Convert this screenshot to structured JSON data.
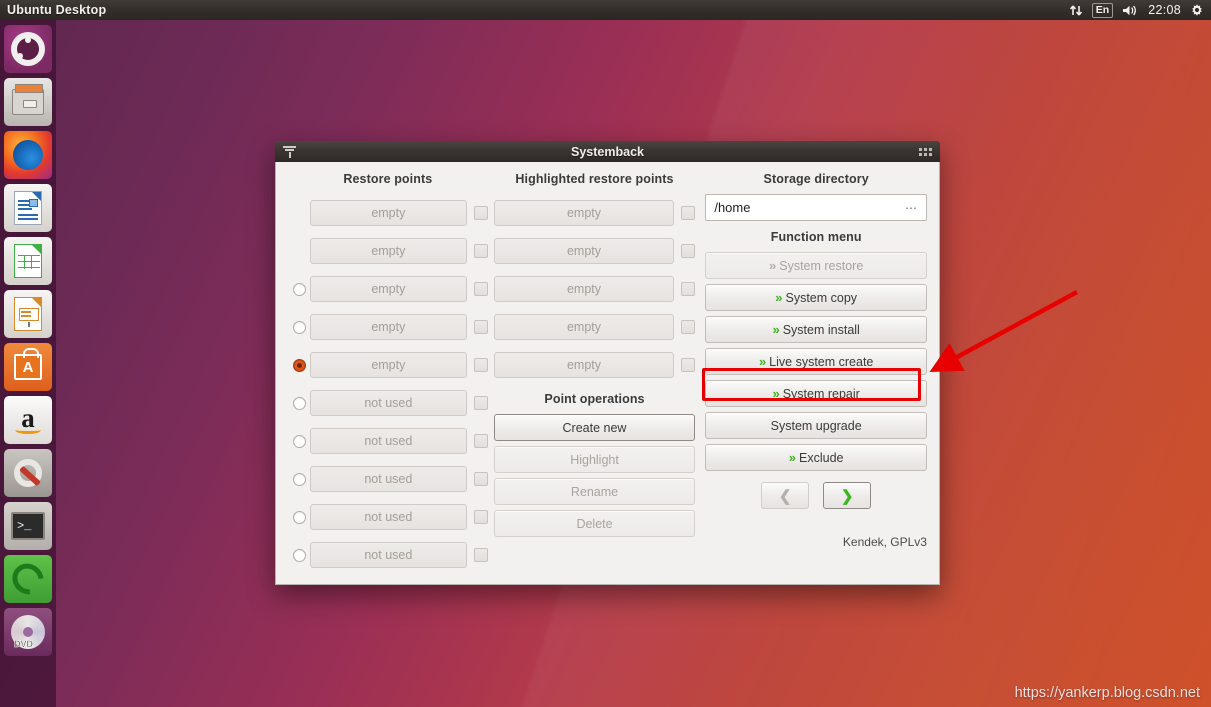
{
  "panel": {
    "title": "Ubuntu Desktop",
    "indicators": {
      "network_icon": "network-updown-icon",
      "keyboard": "En",
      "volume_icon": "volume-icon",
      "clock": "22:08",
      "gear_icon": "gear-icon"
    }
  },
  "launcher": {
    "items": [
      {
        "name": "ubuntu-dash",
        "label": "Ubuntu Dash"
      },
      {
        "name": "files",
        "label": "Files"
      },
      {
        "name": "firefox",
        "label": "Firefox"
      },
      {
        "name": "libreoffice-writer",
        "label": "LibreOffice Writer"
      },
      {
        "name": "libreoffice-calc",
        "label": "LibreOffice Calc"
      },
      {
        "name": "libreoffice-impress",
        "label": "LibreOffice Impress"
      },
      {
        "name": "ubuntu-software",
        "label": "Ubuntu Software"
      },
      {
        "name": "amazon",
        "label": "Amazon"
      },
      {
        "name": "system-settings",
        "label": "System Settings"
      },
      {
        "name": "terminal",
        "label": "Terminal"
      },
      {
        "name": "systemback",
        "label": "Systemback"
      },
      {
        "name": "dvd",
        "label": "DVD"
      }
    ]
  },
  "window": {
    "title": "Systemback",
    "columns": {
      "restore_points_header": "Restore points",
      "highlighted_header": "Highlighted restore points",
      "storage_header": "Storage directory"
    },
    "restore_points": [
      {
        "label": "empty",
        "radio": "none"
      },
      {
        "label": "empty",
        "radio": "none"
      },
      {
        "label": "empty",
        "radio": "off"
      },
      {
        "label": "empty",
        "radio": "off"
      },
      {
        "label": "empty",
        "radio": "on"
      },
      {
        "label": "not used",
        "radio": "off"
      },
      {
        "label": "not used",
        "radio": "off"
      },
      {
        "label": "not used",
        "radio": "off"
      },
      {
        "label": "not used",
        "radio": "off"
      },
      {
        "label": "not used",
        "radio": "off"
      }
    ],
    "highlighted_points": [
      {
        "label": "empty"
      },
      {
        "label": "empty"
      },
      {
        "label": "empty"
      },
      {
        "label": "empty"
      },
      {
        "label": "empty"
      }
    ],
    "point_operations": {
      "header": "Point operations",
      "buttons": [
        {
          "label": "Create new",
          "state": "default"
        },
        {
          "label": "Highlight",
          "state": "disabled"
        },
        {
          "label": "Rename",
          "state": "disabled"
        },
        {
          "label": "Delete",
          "state": "disabled"
        }
      ]
    },
    "storage": {
      "path_value": "/home",
      "browse_glyph": "⋯"
    },
    "function_menu": {
      "header": "Function menu",
      "buttons": [
        {
          "label": "System restore",
          "state": "disabled",
          "chevron": true
        },
        {
          "label": "System copy",
          "state": "normal",
          "chevron": true
        },
        {
          "label": "System install",
          "state": "normal",
          "chevron": true
        },
        {
          "label": "Live system create",
          "state": "normal",
          "chevron": true,
          "highlighted": true
        },
        {
          "label": "System repair",
          "state": "normal",
          "chevron": true
        },
        {
          "label": "System upgrade",
          "state": "normal",
          "chevron": false
        },
        {
          "label": "Exclude",
          "state": "normal",
          "chevron": true
        }
      ]
    },
    "navigation": {
      "back_glyph": "❮",
      "forward_glyph": "❯"
    },
    "credit": "Kendek, GPLv3"
  },
  "annotation": {
    "highlight_color": "#e60000",
    "target_label": "Live system create"
  },
  "watermark": "https://yankerp.blog.csdn.net"
}
